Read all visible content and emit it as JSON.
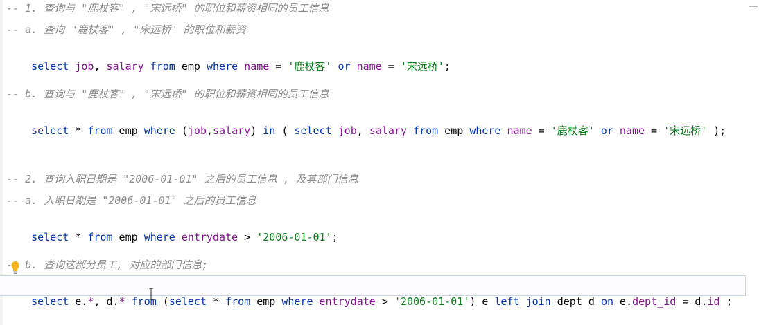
{
  "lines": {
    "l1": "-- 1. 查询与 \"鹿杖客\" , \"宋远桥\" 的职位和薪资相同的员工信息",
    "l2": "-- a. 查询 \"鹿杖客\" , \"宋远桥\" 的职位和薪资",
    "l3": {
      "s1": "select",
      "s2": " job",
      "s3": ", ",
      "s4": "salary",
      "s5": " from",
      "s6": " emp ",
      "s7": "where",
      "s8": " name",
      "s9": " = ",
      "s10": "'鹿杖客'",
      "s11": " or",
      "s12": " name",
      "s13": " = ",
      "s14": "'宋远桥'",
      "s15": ";"
    },
    "l4": "-- b. 查询与 \"鹿杖客\" , \"宋远桥\" 的职位和薪资相同的员工信息",
    "l5": {
      "s1": "select",
      "s2": " * ",
      "s3": "from",
      "s4": " emp ",
      "s5": "where",
      "s6": " (",
      "s7": "job",
      "s8": ",",
      "s9": "salary",
      "s10": ") ",
      "s11": "in",
      "s12": " ( ",
      "s13": "select",
      "s14": " job",
      "s15": ", ",
      "s16": "salary",
      "s17": " from",
      "s18": " emp ",
      "s19": "where",
      "s20": " name",
      "s21": " = ",
      "s22": "'鹿杖客'",
      "s23": " or",
      "s24": " name",
      "s25": " = ",
      "s26": "'宋远桥'",
      "s27": " );"
    },
    "l6": "-- 2. 查询入职日期是 \"2006-01-01\" 之后的员工信息 , 及其部门信息",
    "l7": "-- a. 入职日期是 \"2006-01-01\" 之后的员工信息",
    "l8": {
      "s1": "select",
      "s2": " * ",
      "s3": "from",
      "s4": " emp ",
      "s5": "where",
      "s6": " entrydate",
      "s7": " > ",
      "s8": "'2006-01-01'",
      "s9": ";"
    },
    "l9": "-- b. 查询这部分员工, 对应的部门信息;",
    "l10": {
      "s1": "select",
      "s2": " e.",
      "s3": "*",
      "s4": ", d.",
      "s5": "*",
      "s6": " from",
      "s7": " (",
      "s8": "select",
      "s9": " * ",
      "s10": "from",
      "s11": " emp ",
      "s12": "where",
      "s13": " entrydate",
      "s14": " > ",
      "s15": "'2006-01-01'",
      "s16": ") e ",
      "s17": "left join",
      "s18": " dept d ",
      "s19": "on",
      "s20": " e.",
      "s21": "dept_id",
      "s22": " = d.",
      "s23": "id",
      "s24": " ;"
    }
  },
  "colors": {
    "keyword": "#0033b3",
    "column": "#871094",
    "string": "#067d17",
    "comment": "#8c8c8c"
  },
  "icons": {
    "bulb": "lightbulb-icon",
    "caret": "text-cursor-icon"
  }
}
